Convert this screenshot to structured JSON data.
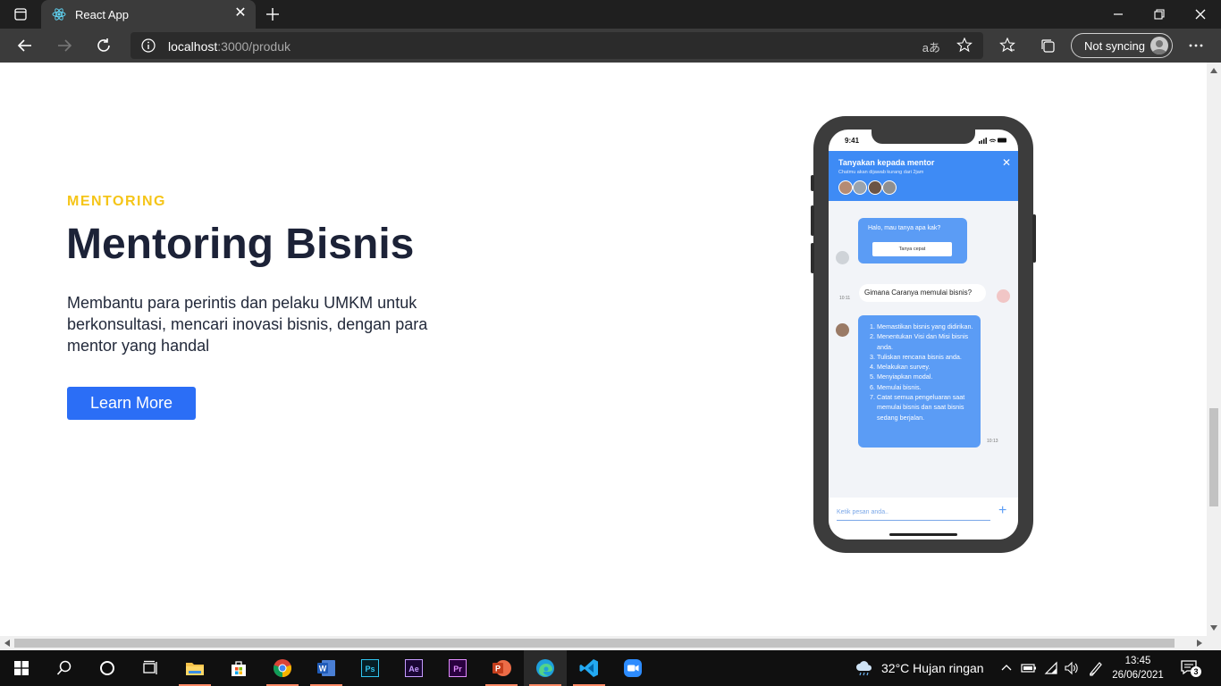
{
  "browser": {
    "tab_title": "React App",
    "url_host": "localhost",
    "url_path": ":3000/produk",
    "sync_label": "Not syncing"
  },
  "hero": {
    "eyebrow": "MENTORING",
    "headline": "Mentoring Bisnis",
    "description": "Membantu para perintis dan pelaku UMKM untuk berkonsultasi, mencari inovasi bisnis, dengan para mentor yang handal",
    "cta_label": "Learn More"
  },
  "phone": {
    "status_time": "9:41",
    "chat_title": "Tanyakan kepada mentor",
    "chat_subtitle": "Chatmu akan dijawab kurang dari 2jam",
    "greeting": "Halo, mau tanya apa kak?",
    "quick_chip": "Tanya cepat",
    "user_question": "Gimana Caranya memulai bisnis?",
    "time_question": "10:11",
    "answer_items": [
      "Memastikan bisnis yang didirikan.",
      "Menentukan Visi dan Misi bisnis anda.",
      "Tuliskan rencana bisnis anda.",
      "Melakukan survey.",
      "Menyiapkan modal.",
      "Memulai bisnis.",
      "Catat semua pengeluaran saat memulai bisnis dan saat bisnis sedang berjalan."
    ],
    "time_answer": "10:13",
    "input_placeholder": "Ketik pesan anda..",
    "mentor_avatar_colors": [
      "#b58b74",
      "#9aa3ad",
      "#6b5446",
      "#8f8f8f"
    ]
  },
  "taskbar": {
    "weather": "32°C  Hujan ringan",
    "time": "13:45",
    "date": "26/06/2021",
    "notifications": "3"
  },
  "colors": {
    "accent_blue": "#2b6ef6",
    "eyebrow_yellow": "#f5c518",
    "chat_blue": "#3e8bf5"
  }
}
